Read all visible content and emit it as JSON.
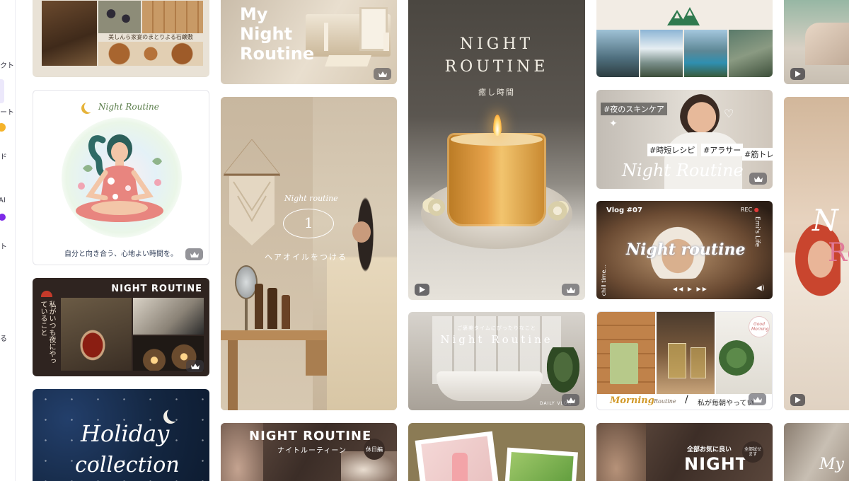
{
  "sidebar": {
    "items": [
      {
        "label": "クト"
      },
      {
        "label": "ート"
      },
      {
        "label": "ド"
      },
      {
        "label": "AI"
      },
      {
        "label": "ト"
      },
      {
        "label": "る"
      }
    ]
  },
  "cards": {
    "food_collage": {
      "caption": "美しんら家宴のまとりよる石鹸敷"
    },
    "my_night": {
      "title_line1": "My",
      "title_line2": "Night",
      "title_line3": "Routine"
    },
    "candle": {
      "title_line1": "NIGHT",
      "title_line2": "ROUTINE",
      "subtitle": "癒し時間"
    },
    "mountains": {},
    "partial_top_right": {},
    "meditation": {
      "title": "Night Routine",
      "caption": "自分と向き合う、心地よい時間を。"
    },
    "hair_oil": {
      "script": "Night routine",
      "number": "1",
      "caption": "ヘアオイルをつける"
    },
    "skincare": {
      "tag1": "#夜のスキンケア",
      "tag2": "#時短レシピ",
      "tag3": "#アラサー",
      "tag4": "#筋トレ",
      "title": "Night Routine"
    },
    "vlog": {
      "vlog_label": "Vlog #07",
      "rec_label": "REC",
      "side_text": "Emi's Life",
      "left_text": "chill time...",
      "title": "Night routine"
    },
    "partial_right_tall": {
      "title_line1": "N",
      "title_line2": "Ro"
    },
    "dark_tea": {
      "title": "NIGHT ROUTINE",
      "side_text": "私がいつも夜にやっていること"
    },
    "bathtub": {
      "top_text": "ご褒美タイムにぴったりなこと",
      "title": "Night Routine",
      "brand": "DAILY VLOG"
    },
    "morning": {
      "title_script": "Morning",
      "title_small": "Routine",
      "caption": "私が毎朝やってい",
      "badge": "Good Morning"
    },
    "holiday": {
      "line1": "Holiday",
      "line2": "collection"
    },
    "night_jp": {
      "title": "NIGHT ROUTINE",
      "subtitle": "ナイトルーティーン",
      "badge": "休日編"
    },
    "products": {},
    "bottom_night": {
      "top_text": "全部お気に良い",
      "title": "NIGHT",
      "badge": "全部試せます"
    },
    "partial_bottom_right": {
      "title": "My"
    }
  },
  "colors": {
    "accent": "#7d2ae8",
    "crown_badge": "#3c3c46"
  }
}
